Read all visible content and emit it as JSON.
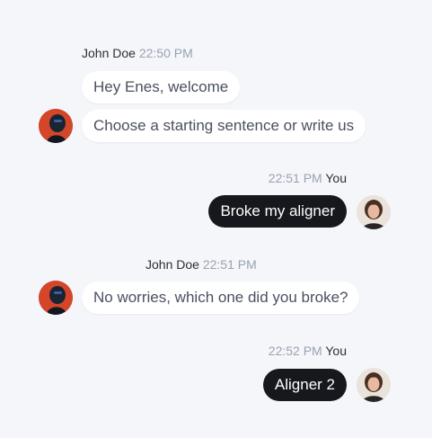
{
  "messages": [
    {
      "author": "John Doe",
      "time": "22:50 PM",
      "lines": [
        "Hey Enes, welcome",
        "Choose a starting sentence or write us"
      ]
    },
    {
      "author": "You",
      "time": "22:51 PM",
      "lines": [
        "Broke my aligner"
      ]
    },
    {
      "author": "John Doe",
      "time": "22:51 PM",
      "lines": [
        "No worries, which one did you broke?"
      ]
    },
    {
      "author": "You",
      "time": "22:52 PM",
      "lines": [
        "Aligner 2"
      ]
    }
  ],
  "avatars": {
    "agent": "agent-avatar",
    "user": "user-avatar"
  },
  "colors": {
    "background": "#F4F6FA",
    "incoming_bubble": "#FFFFFF",
    "outgoing_bubble": "#16181D",
    "timestamp": "#9AA2B1"
  }
}
